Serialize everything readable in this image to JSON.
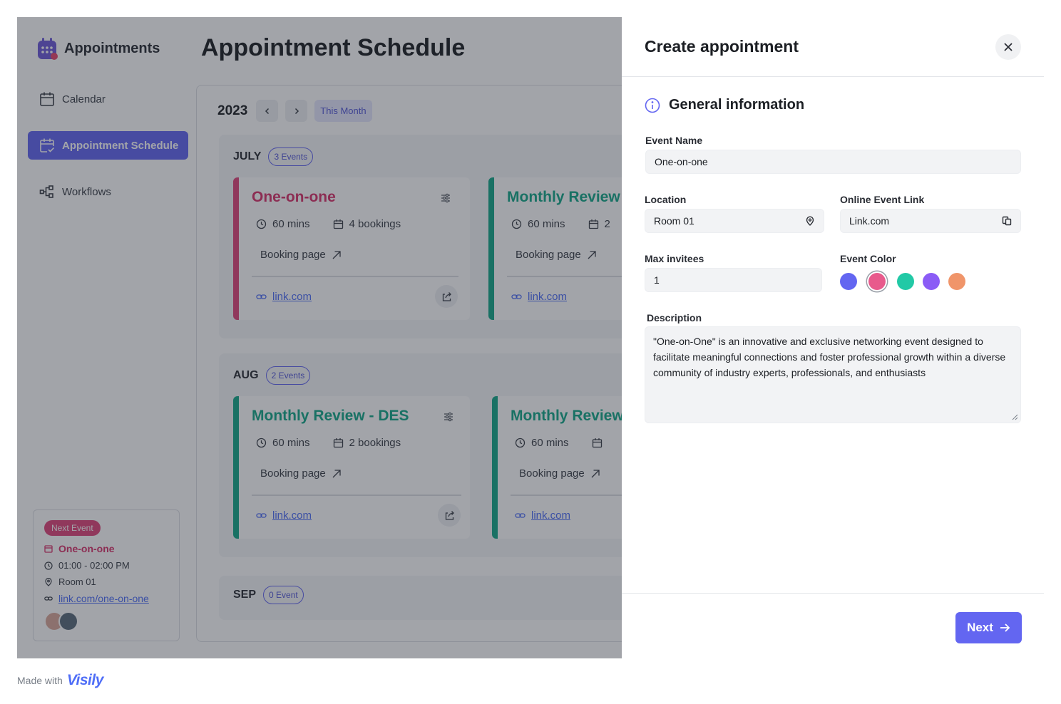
{
  "app": {
    "name": "Appointments"
  },
  "sidebar": {
    "items": [
      {
        "label": "Calendar",
        "icon": "calendar-icon"
      },
      {
        "label": "Appointment Schedule",
        "icon": "calendar-check-icon",
        "active": true
      },
      {
        "label": "Workflows",
        "icon": "workflow-icon"
      }
    ]
  },
  "next_event": {
    "badge": "Next Event",
    "title": "One-on-one",
    "time": "01:00 - 02:00 PM",
    "location": "Room 01",
    "link": "link.com/one-on-one"
  },
  "main": {
    "title": "Appointment Schedule",
    "year": "2023",
    "this_month": "This Month",
    "months": [
      {
        "name": "JULY",
        "count": "3 Events",
        "events": [
          {
            "title": "One-on-one",
            "duration": "60 mins",
            "bookings": "4 bookings",
            "booking_page": "Booking page",
            "link": "link.com",
            "color": "#e0457a"
          },
          {
            "title": "Monthly Review",
            "duration": "60 mins",
            "bookings": "2",
            "booking_page": "Booking page",
            "link": "link.com",
            "color": "#14a889"
          }
        ]
      },
      {
        "name": "AUG",
        "count": "2 Events",
        "events": [
          {
            "title": "Monthly Review - DES",
            "duration": "60 mins",
            "bookings": "2 bookings",
            "booking_page": "Booking page",
            "link": "link.com",
            "color": "#14a889"
          },
          {
            "title": "Monthly Review",
            "duration": "60 mins",
            "bookings": "",
            "booking_page": "Booking page",
            "link": "link.com",
            "color": "#14a889"
          }
        ]
      },
      {
        "name": "SEP",
        "count": "0 Event",
        "events": []
      }
    ]
  },
  "modal": {
    "title": "Create appointment",
    "section": "General information",
    "event_name": {
      "label": "Event Name",
      "value": "One-on-one"
    },
    "location": {
      "label": "Location",
      "value": "Room 01"
    },
    "online_link": {
      "label": "Online Event Link",
      "value": "Link.com"
    },
    "max_invitees": {
      "label": "Max invitees",
      "value": "1"
    },
    "event_color": {
      "label": "Event Color",
      "options": [
        "#6366f1",
        "#e85a8c",
        "#22c9a6",
        "#8b5cf6",
        "#f0956a"
      ],
      "selected": "#e85a8c"
    },
    "description": {
      "label": "Description",
      "value": "\"One-on-One\" is an innovative and exclusive networking event designed to facilitate meaningful connections and foster professional growth within a diverse community of industry experts, professionals, and enthusiasts"
    },
    "next_label": "Next"
  },
  "footer": {
    "made_with": "Made with",
    "brand": "Visily"
  }
}
